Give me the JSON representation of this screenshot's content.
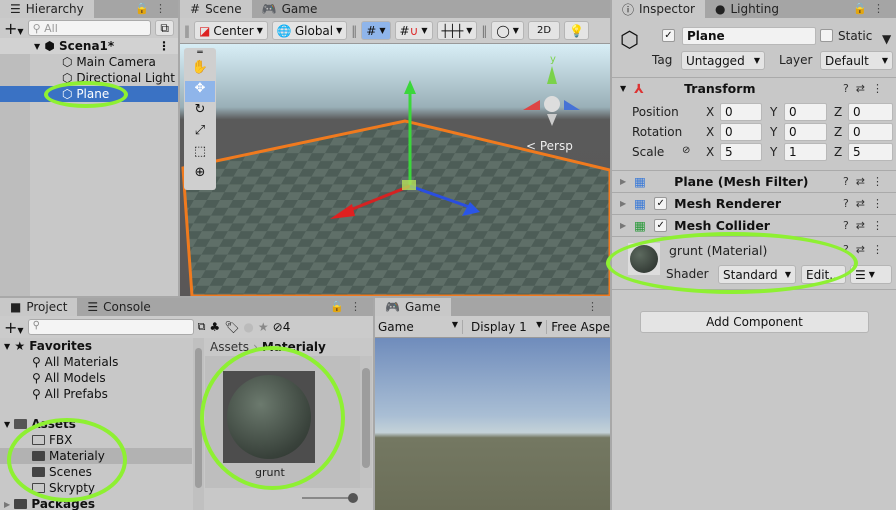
{
  "hierarchy": {
    "tab": "Hierarchy",
    "search_placeholder": "All",
    "scene": "Scena1*",
    "items": [
      "Main Camera",
      "Directional Light",
      "Plane"
    ],
    "selected": "Plane"
  },
  "scene_view": {
    "tabs": [
      "Scene",
      "Game"
    ],
    "pivot": "Center",
    "space": "Global",
    "mode_2d": "2D",
    "persp_label": "< Persp",
    "gizmo_axes": [
      "y",
      "x",
      "z"
    ]
  },
  "inspector": {
    "tabs": [
      "Inspector",
      "Lighting"
    ],
    "object_name": "Plane",
    "active": true,
    "static_label": "Static",
    "tag_label": "Tag",
    "tag": "Untagged",
    "layer_label": "Layer",
    "layer": "Default",
    "transform": {
      "title": "Transform",
      "rows": [
        {
          "label": "Position",
          "x": "0",
          "y": "0",
          "z": "0"
        },
        {
          "label": "Rotation",
          "x": "0",
          "y": "0",
          "z": "0"
        },
        {
          "label": "Scale",
          "x": "5",
          "y": "1",
          "z": "5"
        }
      ]
    },
    "components": [
      {
        "name": "Plane (Mesh Filter)",
        "checkbox": false
      },
      {
        "name": "Mesh Renderer",
        "checkbox": true
      },
      {
        "name": "Mesh Collider",
        "checkbox": true
      }
    ],
    "material": {
      "name": "grunt (Material)",
      "shader_label": "Shader",
      "shader": "Standard",
      "edit": "Edit..."
    },
    "add_component": "Add Component"
  },
  "project": {
    "tabs": [
      "Project",
      "Console"
    ],
    "filter_count": "4",
    "favorites": {
      "title": "Favorites",
      "items": [
        "All Materials",
        "All Models",
        "All Prefabs"
      ]
    },
    "assets": {
      "title": "Assets",
      "items": [
        "FBX",
        "Materialy",
        "Scenes",
        "Skrypty"
      ],
      "selected": "Materialy"
    },
    "packages": "Packages",
    "breadcrumb": [
      "Assets",
      "Materialy"
    ],
    "files": [
      {
        "name": "grunt"
      }
    ]
  },
  "game": {
    "tab": "Game",
    "mode": "Game",
    "display": "Display 1",
    "aspect": "Free Aspe"
  },
  "colors": {
    "selection": "#3a72c4",
    "highlight_ring": "#8ef032",
    "plane_outline": "#f07a1e"
  }
}
